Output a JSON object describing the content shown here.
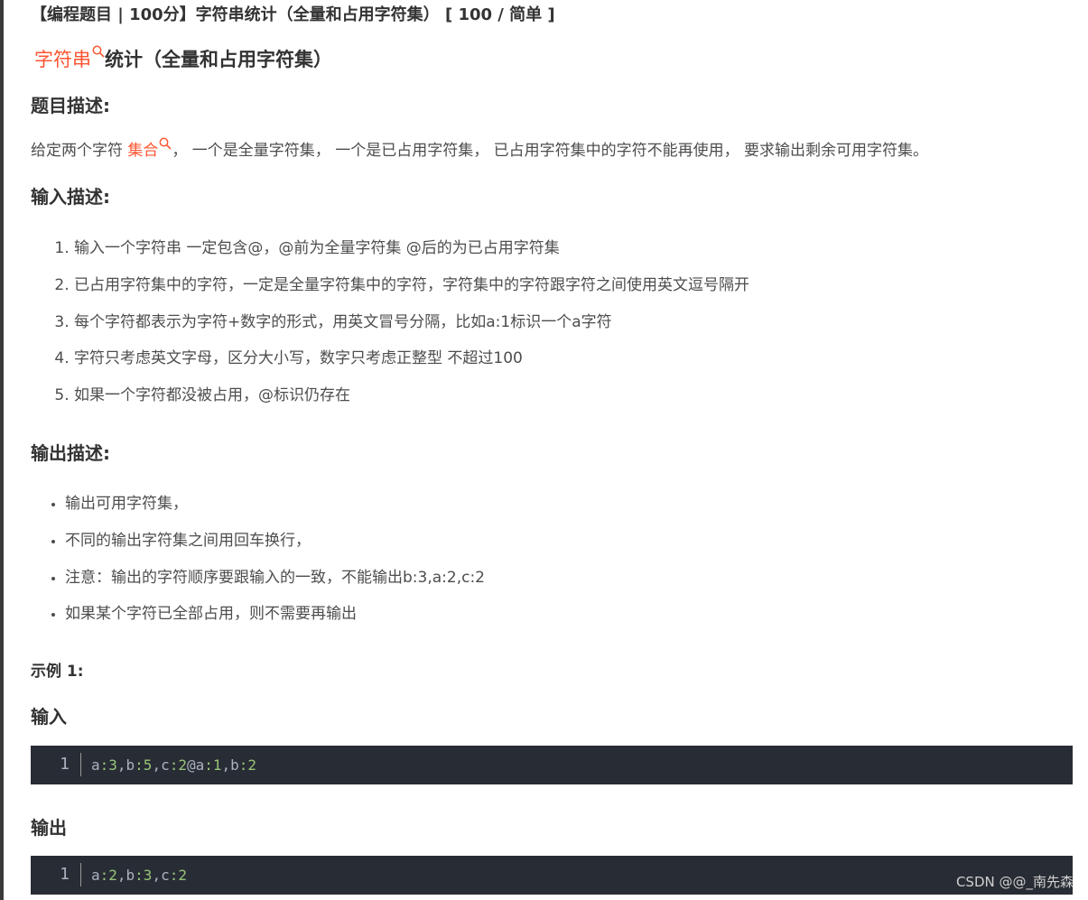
{
  "header": {
    "title": "【编程题目 | 100分】字符串统计（全量和占用字符集） [ 100 / 简单 ]"
  },
  "article": {
    "title_keyword": "字符串",
    "title_rest": "统计（全量和占用字符集）",
    "section_desc": "题目描述:",
    "desc_before": "给定两个字符",
    "desc_keyword": "集合",
    "desc_after": "，  一个是全量字符集，  一个是已占用字符集，  已占用字符集中的字符不能再使用，  要求输出剩余可用字符集。",
    "section_input": "输入描述:",
    "input_items": [
      "输入一个字符串 一定包含@，@前为全量字符集 @后的为已占用字符集",
      "已占用字符集中的字符，一定是全量字符集中的字符，字符集中的字符跟字符之间使用英文逗号隔开",
      "每个字符都表示为字符+数字的形式，用英文冒号分隔，比如a:1标识一个a字符",
      "字符只考虑英文字母，区分大小写，数字只考虑正整型 不超过100",
      "如果一个字符都没被占用，@标识仍存在"
    ],
    "section_output": "输出描述:",
    "output_items": [
      "输出可用字符集，",
      "不同的输出字符集之间用回车换行，",
      "注意：输出的字符顺序要跟输入的一致，不能输出b:3,a:2,c:2",
      "如果某个字符已全部占用，则不需要再输出"
    ],
    "example_label": "示例 1:",
    "example_input_label": "输入",
    "example_input_code": {
      "line_number": "1",
      "tokens": [
        "a",
        ":3",
        ",b",
        ":5",
        ",c",
        ":2",
        "@a",
        ":1",
        ",b",
        ":2"
      ]
    },
    "example_output_label": "输出",
    "example_output_code": {
      "line_number": "1",
      "tokens": [
        "a",
        ":2",
        ",b",
        ":3",
        ",c",
        ":2"
      ]
    }
  },
  "watermark": "CSDN @@_南先森",
  "colors": {
    "keyword_link": "#fc5531",
    "code_bg": "#282c34",
    "code_text": "#abb2bf",
    "code_number": "#98c379"
  },
  "icons": {
    "keyword_search": "search-icon"
  }
}
